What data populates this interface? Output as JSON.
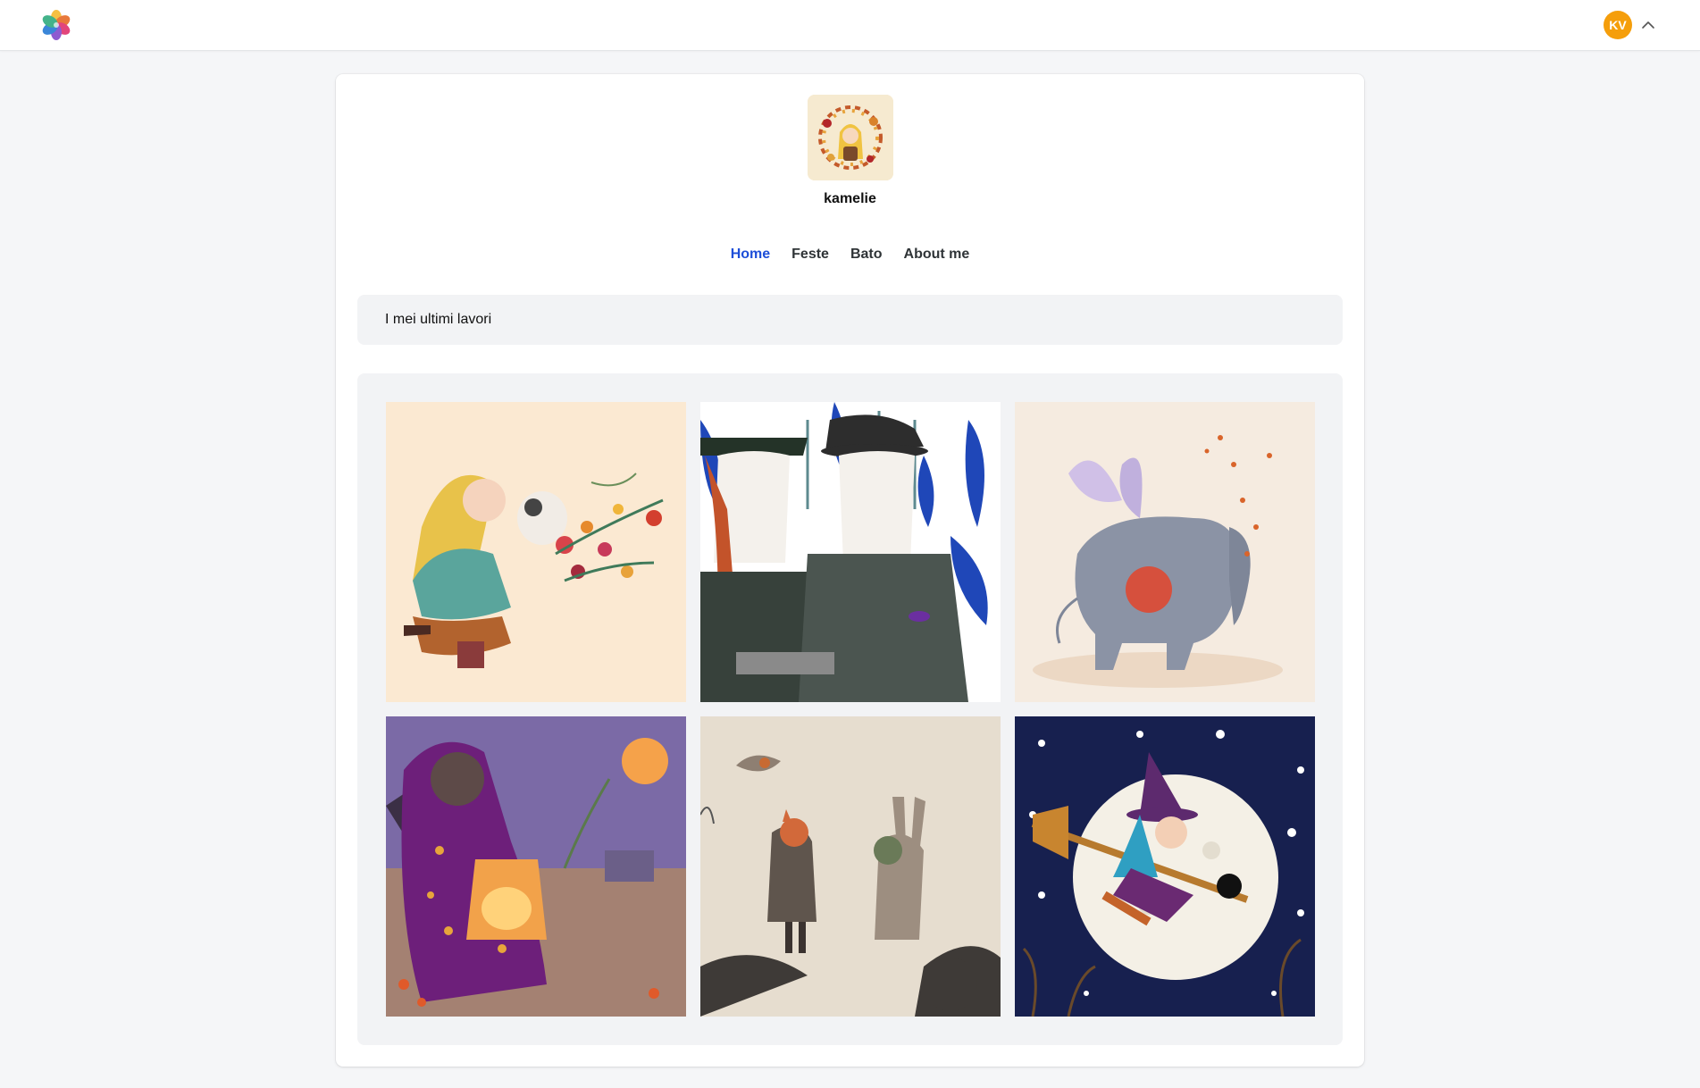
{
  "topbar": {
    "logo_icon": "app-logo-flower-icon",
    "user_initials": "KV",
    "avatar_color": "#f59e0b",
    "menu_icon": "chevron-up-icon"
  },
  "profile": {
    "name": "kamelie",
    "avatar_description": "illustrated portrait of a blonde girl inside a floral wreath"
  },
  "nav": {
    "items": [
      {
        "label": "Home",
        "active": true
      },
      {
        "label": "Feste",
        "active": false
      },
      {
        "label": "Bato",
        "active": false
      },
      {
        "label": "About me",
        "active": false
      }
    ],
    "active_color": "#1d4ed8"
  },
  "section": {
    "title": "I mei ultimi lavori"
  },
  "gallery": {
    "items": [
      {
        "subject": "girl with blonde hair kneeling beside a dog with flowers"
      },
      {
        "subject": "red-haired girl and woman wearing hats against blue foliage"
      },
      {
        "subject": "winged grey elephant with falling leaves"
      },
      {
        "subject": "cat-like figure in purple robe holding a glowing lantern"
      },
      {
        "subject": "fox and rabbit walking in sepia landscape with a bird"
      },
      {
        "subject": "blue-haired witch on a broom with a black cat in front of the moon"
      }
    ]
  }
}
